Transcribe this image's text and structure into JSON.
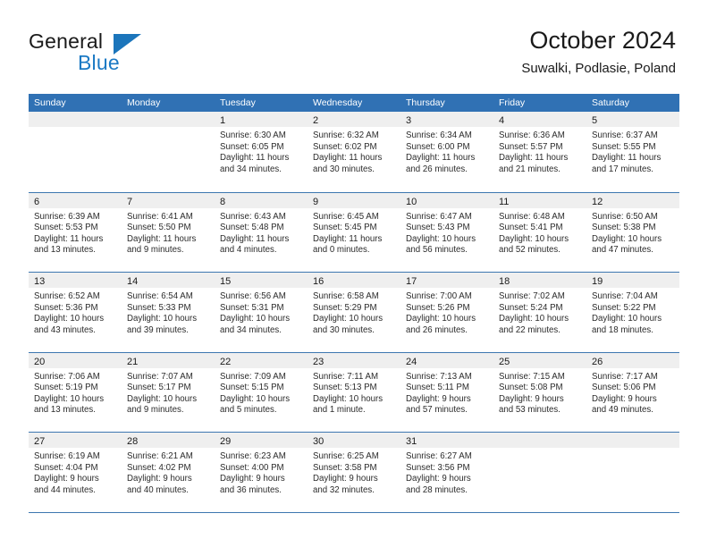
{
  "brand": {
    "line1": "General",
    "line2": "Blue",
    "logo_icon": "triangle-logo-icon",
    "accent_color": "#1b75bb"
  },
  "header": {
    "title": "October 2024",
    "subtitle": "Suwalki, Podlasie, Poland"
  },
  "theme": {
    "header_blue": "#3071b4",
    "row_rule_blue": "#3d77b0",
    "day_band_gray": "#efefef"
  },
  "weekdays": [
    "Sunday",
    "Monday",
    "Tuesday",
    "Wednesday",
    "Thursday",
    "Friday",
    "Saturday"
  ],
  "weeks": [
    [
      {
        "day": "",
        "sunrise": "",
        "sunset": "",
        "daylight1": "",
        "daylight2": ""
      },
      {
        "day": "",
        "sunrise": "",
        "sunset": "",
        "daylight1": "",
        "daylight2": ""
      },
      {
        "day": "1",
        "sunrise": "Sunrise: 6:30 AM",
        "sunset": "Sunset: 6:05 PM",
        "daylight1": "Daylight: 11 hours",
        "daylight2": "and 34 minutes."
      },
      {
        "day": "2",
        "sunrise": "Sunrise: 6:32 AM",
        "sunset": "Sunset: 6:02 PM",
        "daylight1": "Daylight: 11 hours",
        "daylight2": "and 30 minutes."
      },
      {
        "day": "3",
        "sunrise": "Sunrise: 6:34 AM",
        "sunset": "Sunset: 6:00 PM",
        "daylight1": "Daylight: 11 hours",
        "daylight2": "and 26 minutes."
      },
      {
        "day": "4",
        "sunrise": "Sunrise: 6:36 AM",
        "sunset": "Sunset: 5:57 PM",
        "daylight1": "Daylight: 11 hours",
        "daylight2": "and 21 minutes."
      },
      {
        "day": "5",
        "sunrise": "Sunrise: 6:37 AM",
        "sunset": "Sunset: 5:55 PM",
        "daylight1": "Daylight: 11 hours",
        "daylight2": "and 17 minutes."
      }
    ],
    [
      {
        "day": "6",
        "sunrise": "Sunrise: 6:39 AM",
        "sunset": "Sunset: 5:53 PM",
        "daylight1": "Daylight: 11 hours",
        "daylight2": "and 13 minutes."
      },
      {
        "day": "7",
        "sunrise": "Sunrise: 6:41 AM",
        "sunset": "Sunset: 5:50 PM",
        "daylight1": "Daylight: 11 hours",
        "daylight2": "and 9 minutes."
      },
      {
        "day": "8",
        "sunrise": "Sunrise: 6:43 AM",
        "sunset": "Sunset: 5:48 PM",
        "daylight1": "Daylight: 11 hours",
        "daylight2": "and 4 minutes."
      },
      {
        "day": "9",
        "sunrise": "Sunrise: 6:45 AM",
        "sunset": "Sunset: 5:45 PM",
        "daylight1": "Daylight: 11 hours",
        "daylight2": "and 0 minutes."
      },
      {
        "day": "10",
        "sunrise": "Sunrise: 6:47 AM",
        "sunset": "Sunset: 5:43 PM",
        "daylight1": "Daylight: 10 hours",
        "daylight2": "and 56 minutes."
      },
      {
        "day": "11",
        "sunrise": "Sunrise: 6:48 AM",
        "sunset": "Sunset: 5:41 PM",
        "daylight1": "Daylight: 10 hours",
        "daylight2": "and 52 minutes."
      },
      {
        "day": "12",
        "sunrise": "Sunrise: 6:50 AM",
        "sunset": "Sunset: 5:38 PM",
        "daylight1": "Daylight: 10 hours",
        "daylight2": "and 47 minutes."
      }
    ],
    [
      {
        "day": "13",
        "sunrise": "Sunrise: 6:52 AM",
        "sunset": "Sunset: 5:36 PM",
        "daylight1": "Daylight: 10 hours",
        "daylight2": "and 43 minutes."
      },
      {
        "day": "14",
        "sunrise": "Sunrise: 6:54 AM",
        "sunset": "Sunset: 5:33 PM",
        "daylight1": "Daylight: 10 hours",
        "daylight2": "and 39 minutes."
      },
      {
        "day": "15",
        "sunrise": "Sunrise: 6:56 AM",
        "sunset": "Sunset: 5:31 PM",
        "daylight1": "Daylight: 10 hours",
        "daylight2": "and 34 minutes."
      },
      {
        "day": "16",
        "sunrise": "Sunrise: 6:58 AM",
        "sunset": "Sunset: 5:29 PM",
        "daylight1": "Daylight: 10 hours",
        "daylight2": "and 30 minutes."
      },
      {
        "day": "17",
        "sunrise": "Sunrise: 7:00 AM",
        "sunset": "Sunset: 5:26 PM",
        "daylight1": "Daylight: 10 hours",
        "daylight2": "and 26 minutes."
      },
      {
        "day": "18",
        "sunrise": "Sunrise: 7:02 AM",
        "sunset": "Sunset: 5:24 PM",
        "daylight1": "Daylight: 10 hours",
        "daylight2": "and 22 minutes."
      },
      {
        "day": "19",
        "sunrise": "Sunrise: 7:04 AM",
        "sunset": "Sunset: 5:22 PM",
        "daylight1": "Daylight: 10 hours",
        "daylight2": "and 18 minutes."
      }
    ],
    [
      {
        "day": "20",
        "sunrise": "Sunrise: 7:06 AM",
        "sunset": "Sunset: 5:19 PM",
        "daylight1": "Daylight: 10 hours",
        "daylight2": "and 13 minutes."
      },
      {
        "day": "21",
        "sunrise": "Sunrise: 7:07 AM",
        "sunset": "Sunset: 5:17 PM",
        "daylight1": "Daylight: 10 hours",
        "daylight2": "and 9 minutes."
      },
      {
        "day": "22",
        "sunrise": "Sunrise: 7:09 AM",
        "sunset": "Sunset: 5:15 PM",
        "daylight1": "Daylight: 10 hours",
        "daylight2": "and 5 minutes."
      },
      {
        "day": "23",
        "sunrise": "Sunrise: 7:11 AM",
        "sunset": "Sunset: 5:13 PM",
        "daylight1": "Daylight: 10 hours",
        "daylight2": "and 1 minute."
      },
      {
        "day": "24",
        "sunrise": "Sunrise: 7:13 AM",
        "sunset": "Sunset: 5:11 PM",
        "daylight1": "Daylight: 9 hours",
        "daylight2": "and 57 minutes."
      },
      {
        "day": "25",
        "sunrise": "Sunrise: 7:15 AM",
        "sunset": "Sunset: 5:08 PM",
        "daylight1": "Daylight: 9 hours",
        "daylight2": "and 53 minutes."
      },
      {
        "day": "26",
        "sunrise": "Sunrise: 7:17 AM",
        "sunset": "Sunset: 5:06 PM",
        "daylight1": "Daylight: 9 hours",
        "daylight2": "and 49 minutes."
      }
    ],
    [
      {
        "day": "27",
        "sunrise": "Sunrise: 6:19 AM",
        "sunset": "Sunset: 4:04 PM",
        "daylight1": "Daylight: 9 hours",
        "daylight2": "and 44 minutes."
      },
      {
        "day": "28",
        "sunrise": "Sunrise: 6:21 AM",
        "sunset": "Sunset: 4:02 PM",
        "daylight1": "Daylight: 9 hours",
        "daylight2": "and 40 minutes."
      },
      {
        "day": "29",
        "sunrise": "Sunrise: 6:23 AM",
        "sunset": "Sunset: 4:00 PM",
        "daylight1": "Daylight: 9 hours",
        "daylight2": "and 36 minutes."
      },
      {
        "day": "30",
        "sunrise": "Sunrise: 6:25 AM",
        "sunset": "Sunset: 3:58 PM",
        "daylight1": "Daylight: 9 hours",
        "daylight2": "and 32 minutes."
      },
      {
        "day": "31",
        "sunrise": "Sunrise: 6:27 AM",
        "sunset": "Sunset: 3:56 PM",
        "daylight1": "Daylight: 9 hours",
        "daylight2": "and 28 minutes."
      },
      {
        "day": "",
        "sunrise": "",
        "sunset": "",
        "daylight1": "",
        "daylight2": ""
      },
      {
        "day": "",
        "sunrise": "",
        "sunset": "",
        "daylight1": "",
        "daylight2": ""
      }
    ]
  ]
}
